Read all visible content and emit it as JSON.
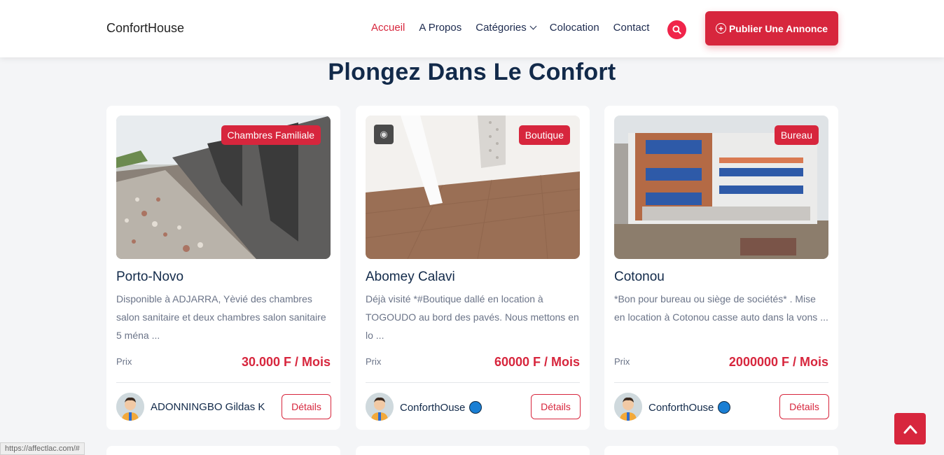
{
  "header": {
    "brand": "ConfortHouse",
    "nav": [
      {
        "label": "Accueil",
        "active": true
      },
      {
        "label": "A Propos",
        "active": false
      },
      {
        "label": "Catégories",
        "active": false,
        "dropdown": true
      },
      {
        "label": "Colocation",
        "active": false
      },
      {
        "label": "Contact",
        "active": false
      }
    ],
    "search_icon": "search-icon",
    "publish_label": "Publier Une Annonce",
    "accent": "#d7263d"
  },
  "main": {
    "title": "Plongez Dans Le Confort",
    "prix_label": "Prix",
    "details_label": "Détails",
    "listings": [
      {
        "category": "Chambres Familiale",
        "city": "Porto-Novo",
        "description": "Disponible à ADJARRA, Yèvié des chambres salon sanitaire et deux chambres salon sanitaire 5 ména ...",
        "price": "30.000 F / Mois",
        "owner": "ADONNINGBO Gildas K",
        "verified": false
      },
      {
        "category": "Boutique",
        "city": "Abomey Calavi",
        "description": "Déjà visité *#Boutique dallé en location à TOGOUDO au bord des pavés. Nous mettons en lo ...",
        "price": "60000 F / Mois",
        "owner": "ConforthOuse",
        "verified": true
      },
      {
        "category": "Bureau",
        "city": "Cotonou",
        "description": "*Bon pour bureau ou siège de sociétés* . Mise en location à Cotonou casse auto dans la vons ...",
        "price": "2000000 F / Mois",
        "owner": "ConforthOuse",
        "verified": true
      }
    ]
  },
  "status_bar": {
    "url": "https://affectlac.com/#"
  }
}
